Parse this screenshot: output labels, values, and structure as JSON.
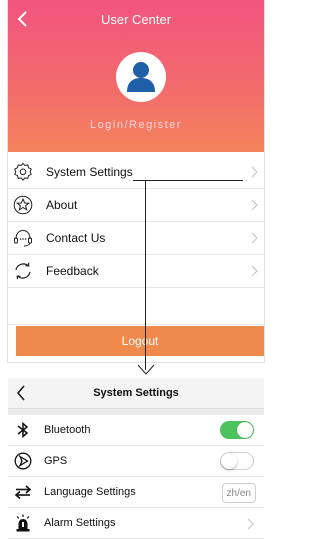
{
  "top_screen": {
    "title": "User Center",
    "login_link": "Login/Register",
    "menu": [
      {
        "label": "System Settings",
        "icon": "gear-icon"
      },
      {
        "label": "About",
        "icon": "star-icon"
      },
      {
        "label": "Contact Us",
        "icon": "headset-icon"
      },
      {
        "label": "Feedback",
        "icon": "refresh-icon"
      }
    ],
    "logout_label": "Logout"
  },
  "bottom_screen": {
    "title": "System Settings",
    "rows": [
      {
        "label": "Bluetooth",
        "icon": "bluetooth-icon",
        "control": "toggle",
        "state": "on"
      },
      {
        "label": "GPS",
        "icon": "gps-icon",
        "control": "toggle",
        "state": "off"
      },
      {
        "label": "Language Settings",
        "icon": "swap-arrows-icon",
        "control": "value",
        "value": "zh/en"
      },
      {
        "label": "Alarm Settings",
        "icon": "alarm-light-icon",
        "control": "chevron"
      }
    ]
  },
  "colors": {
    "header_gradient_top": "#f2547f",
    "header_gradient_bottom": "#f4835c",
    "logout_button": "#f0894c",
    "toggle_on": "#4cc35c"
  }
}
